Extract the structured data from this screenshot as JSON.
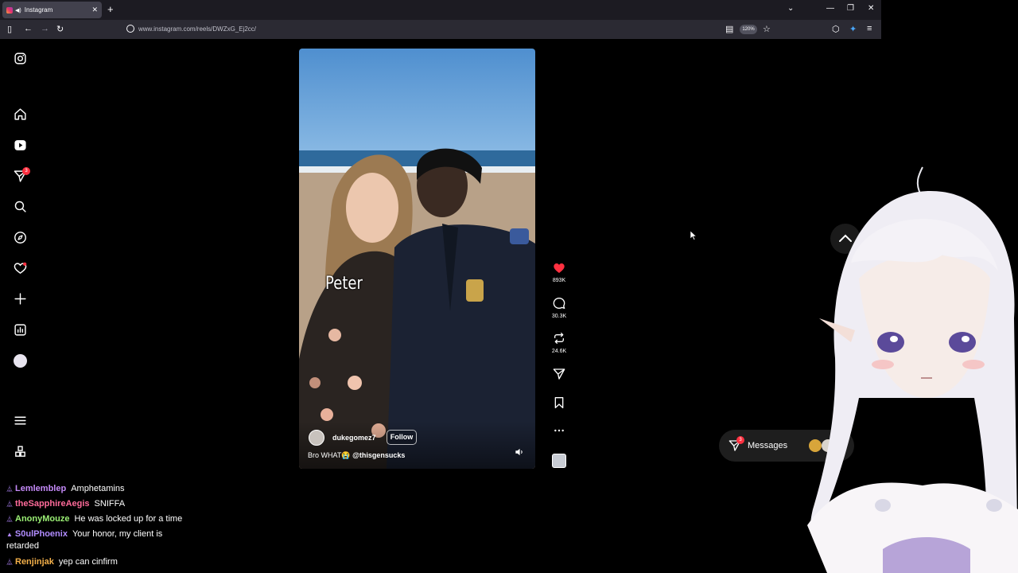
{
  "browser": {
    "tab_title": "Instagram",
    "url": "www.instagram.com/reels/DWZxG_Ej2cc/",
    "zoom_level": "120%"
  },
  "sidebar": {
    "notifications_badge": "3",
    "icons": [
      "instagram-logo-icon",
      "home-icon",
      "reels-icon",
      "messages-icon",
      "search-icon",
      "explore-icon",
      "notifications-icon",
      "create-icon",
      "dashboard-icon",
      "profile-avatar",
      "menu-icon",
      "more-apps-icon"
    ]
  },
  "reel": {
    "overlay_text": "Peter",
    "username": "dukegomez7",
    "follow_label": "Follow",
    "caption_prefix": "Bro WHAT😭",
    "caption_mention": "@thisgensucks"
  },
  "actions": {
    "likes": "893K",
    "comments": "30.3K",
    "reposts": "24.6K"
  },
  "messages": {
    "label": "Messages",
    "badge": "3"
  },
  "chat": [
    {
      "name": "Lemlemblep",
      "color": "#c58af9",
      "message": "Amphetamins"
    },
    {
      "name": "theSapphireAegis",
      "color": "#ff6b9a",
      "message": "SNIFFA"
    },
    {
      "name": "AnonyMouze",
      "color": "#9bf075",
      "message": "He was locked up for a time"
    },
    {
      "name": "S0ulPhoenix",
      "color": "#b18cff",
      "message": "Your honor, my client is retarded"
    },
    {
      "name": "Renjinjak",
      "color": "#f5b14a",
      "message": "yep can cinfirm"
    }
  ],
  "colors": {
    "like_red": "#ff3040",
    "bg": "#000000"
  }
}
